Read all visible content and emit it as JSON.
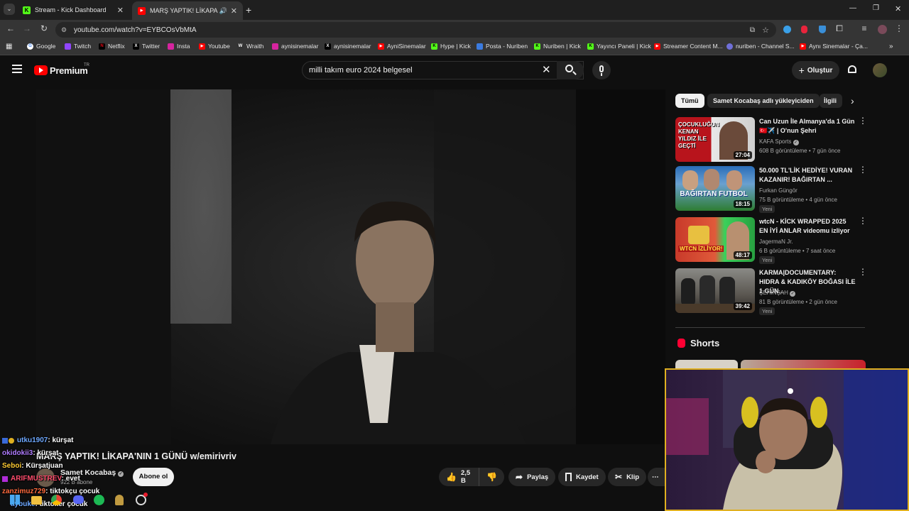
{
  "browser": {
    "tabs": [
      {
        "label": "Stream - Kick Dashboard",
        "active": false
      },
      {
        "label": "MARŞ YAPTIK! LİKAPA'NIN",
        "active": true
      }
    ],
    "url": "youtube.com/watch?v=EYBCOsVbMtA",
    "bookmarks": [
      "Google",
      "Twitch",
      "Netflix",
      "Twitter",
      "Insta",
      "Youtube",
      "Wraith",
      "aynisinemalar",
      "aynisinemalar",
      "AyniSinemalar",
      "Hype | Kick",
      "Posta - Nuriben",
      "Nuriben | Kick",
      "Yayıncı Paneli | Kick",
      "Streamer Content M...",
      "nuriben - Channel S...",
      "Aynı Sinemalar - Ça..."
    ]
  },
  "header": {
    "logo": "Premium",
    "region": "TR",
    "search_value": "milli takım euro 2024 belgesel",
    "create_label": "Oluştur"
  },
  "chips": [
    "Tümü",
    "Samet Kocabaş adlı yükleyiciden",
    "İlgili"
  ],
  "recommendations": [
    {
      "thumb_text": "ÇOCUKLUĞUN KENAN YILDIZ İLE GEÇTİ",
      "duration": "27:04",
      "title": "Can Uzun İle Almanya'da 1 Gün 🇹🇷✈️ | O'nun Şehri",
      "channel": "KAFA Sports",
      "verified": true,
      "meta": "608 B görüntüleme • 7 gün önce",
      "badge": ""
    },
    {
      "thumb_text": "BAĞIRTAN FUTBOL",
      "duration": "18:15",
      "title": "50.000 TL'LİK HEDİYE! VURAN KAZANIR! BAĞIRTAN ...",
      "channel": "Furkan Güngör",
      "verified": false,
      "meta": "75 B görüntüleme • 4 gün önce",
      "badge": "Yeni"
    },
    {
      "thumb_text": "WTCN İZLİYOR!",
      "duration": "48:17",
      "title": "wtcN - KİCK WRAPPED 2025 EN İYİ ANLAR videomu izliyor",
      "channel": "JagermaN Jr.",
      "verified": false,
      "meta": "6 B görüntüleme • 7 saat önce",
      "badge": "Yeni"
    },
    {
      "thumb_text": "",
      "duration": "39:42",
      "title": "KARMA|DOCUMENTARY: HIDRA & KADIKÖY BOĞASI İLE 1 GÜN...",
      "channel": "ŞEHİNŞAH",
      "verified": true,
      "meta": "81 B görüntüleme • 2 gün önce",
      "badge": "Yeni"
    }
  ],
  "shorts_label": "Shorts",
  "video": {
    "title": "MARŞ YAPTIK! LİKAPA'NIN 1 GÜNÜ w/emirivriv",
    "channel": "Samet Kocabaş",
    "subscribers": "922 B abone",
    "subscribe_label": "Abone ol",
    "likes": "2,5 B",
    "share_label": "Paylaş",
    "save_label": "Kaydet",
    "clip_label": "Klip"
  },
  "chat": [
    {
      "user": "utku1907",
      "msg": ": kürşat",
      "color": "#6ea8ff"
    },
    {
      "user": "okidokii3",
      "msg": ": kürşat",
      "color": "#b07cff"
    },
    {
      "user": "Seboi",
      "msg": ": Kürşatjuan",
      "color": "#ffcc33"
    },
    {
      "user": "ARIFMUSTREV",
      "msg": ": evet",
      "color": "#ff4d6d"
    },
    {
      "user": "zanzimuz729",
      "msg": ": tiktokçu çocuk",
      "color": "#ff6a3d"
    },
    {
      "user": "aybuke",
      "msg": ": tiktoker çocuk",
      "color": "#6ea8ff"
    }
  ],
  "colors": {
    "yt_red": "#ff0000",
    "cam_border": "#e0b020",
    "kick_green": "#53fc18"
  }
}
